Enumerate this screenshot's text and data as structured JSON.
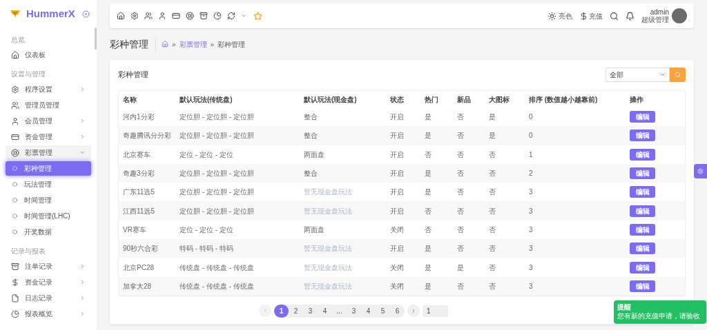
{
  "brand": {
    "name": "HummerX"
  },
  "sidebar": {
    "sections": [
      {
        "title": "总览",
        "items": [
          {
            "label": "仪表板",
            "kind": "link"
          }
        ]
      },
      {
        "title": "设置与管理",
        "items": [
          {
            "label": "程序设置",
            "kind": "menu",
            "expanded": false
          },
          {
            "label": "管理员管理",
            "kind": "link"
          },
          {
            "label": "会员管理",
            "kind": "menu",
            "expanded": false
          },
          {
            "label": "资金管理",
            "kind": "menu",
            "expanded": false
          },
          {
            "label": "彩票管理",
            "kind": "menu",
            "expanded": true,
            "children": [
              {
                "label": "彩种管理",
                "selected": true
              },
              {
                "label": "玩法管理",
                "selected": false
              },
              {
                "label": "时间管理",
                "selected": false
              },
              {
                "label": "时间管理(LHC)",
                "selected": false
              },
              {
                "label": "开奖数据",
                "selected": false
              }
            ]
          }
        ]
      },
      {
        "title": "记录与报表",
        "items": [
          {
            "label": "注单记录",
            "kind": "menu",
            "expanded": false
          },
          {
            "label": "资金记录",
            "kind": "menu",
            "expanded": false
          },
          {
            "label": "日志记录",
            "kind": "menu",
            "expanded": false
          },
          {
            "label": "报表概览",
            "kind": "menu",
            "expanded": false
          }
        ]
      }
    ]
  },
  "topbar": {
    "theme": "亮色",
    "recharge": "充值",
    "user": {
      "name": "admin",
      "role": "超级管理"
    }
  },
  "page": {
    "title": "彩种管理",
    "breadcrumb": [
      "彩票管理",
      "彩种管理"
    ],
    "separator": "»"
  },
  "card": {
    "title": "彩种管理",
    "filter": {
      "value": "全部"
    }
  },
  "table": {
    "columns": [
      "名称",
      "默认玩法(传统盘)",
      "默认玩法(现金盘)",
      "状态",
      "热门",
      "新品",
      "大图标",
      "排序 (数值越小越靠前)",
      "操作"
    ],
    "rows": [
      {
        "name": "河内1分彩",
        "traditional": "定位胆 - 定位胆 - 定位胆",
        "cash": "整合",
        "cash_available": true,
        "status": "开启",
        "hot": "是",
        "new": "否",
        "big_icon": "是",
        "sort": "0",
        "action": "编辑"
      },
      {
        "name": "奇趣腾讯分分彩",
        "traditional": "定位胆 - 定位胆 - 定位胆",
        "cash": "整合",
        "cash_available": true,
        "status": "开启",
        "hot": "是",
        "new": "否",
        "big_icon": "是",
        "sort": "0",
        "action": "编辑"
      },
      {
        "name": "北京赛车",
        "traditional": "定位 - 定位 - 定位",
        "cash": "两面盘",
        "cash_available": true,
        "status": "开启",
        "hot": "否",
        "new": "否",
        "big_icon": "否",
        "sort": "1",
        "action": "编辑"
      },
      {
        "name": "奇趣3分彩",
        "traditional": "定位胆 - 定位胆 - 定位胆",
        "cash": "整合",
        "cash_available": true,
        "status": "开启",
        "hot": "是",
        "new": "否",
        "big_icon": "否",
        "sort": "2",
        "action": "编辑"
      },
      {
        "name": "广东11选5",
        "traditional": "定位胆 - 定位胆 - 定位胆",
        "cash": "暂无现金盘玩法",
        "cash_available": false,
        "status": "开启",
        "hot": "是",
        "new": "否",
        "big_icon": "否",
        "sort": "3",
        "action": "编辑"
      },
      {
        "name": "江西11选5",
        "traditional": "定位胆 - 定位胆 - 定位胆",
        "cash": "暂无现金盘玩法",
        "cash_available": false,
        "status": "开启",
        "hot": "否",
        "new": "否",
        "big_icon": "否",
        "sort": "3",
        "action": "编辑"
      },
      {
        "name": "VR赛车",
        "traditional": "定位 - 定位 - 定位",
        "cash": "两面盘",
        "cash_available": true,
        "status": "关闭",
        "hot": "否",
        "new": "否",
        "big_icon": "否",
        "sort": "3",
        "action": "编辑"
      },
      {
        "name": "90秒六合彩",
        "traditional": "特码 - 特码 - 特码",
        "cash": "暂无现金盘玩法",
        "cash_available": false,
        "status": "开启",
        "hot": "是",
        "new": "否",
        "big_icon": "否",
        "sort": "3",
        "action": "编辑"
      },
      {
        "name": "北京PC28",
        "traditional": "传统盘 - 传统盘 - 传统盘",
        "cash": "暂无现金盘玩法",
        "cash_available": false,
        "status": "关闭",
        "hot": "是",
        "new": "是",
        "big_icon": "否",
        "sort": "3",
        "action": "编辑"
      },
      {
        "name": "加拿大28",
        "traditional": "传统盘 - 传统盘 - 传统盘",
        "cash": "暂无现金盘玩法",
        "cash_available": false,
        "status": "关闭",
        "hot": "是",
        "new": "否",
        "big_icon": "否",
        "sort": "3",
        "action": "编辑"
      }
    ]
  },
  "pagination": {
    "pages": [
      {
        "label": "1",
        "selected": true
      },
      {
        "label": "2",
        "selected": false
      },
      {
        "label": "3",
        "selected": false
      },
      {
        "label": "4",
        "selected": false
      },
      {
        "label": "...",
        "selected": false
      },
      {
        "label": "3",
        "selected": false
      },
      {
        "label": "4",
        "selected": false
      },
      {
        "label": "5",
        "selected": false
      },
      {
        "label": "6",
        "selected": false
      }
    ],
    "jump": "1"
  },
  "toast": {
    "title": "提醒",
    "message": "您有新的充值申请，请验收"
  }
}
